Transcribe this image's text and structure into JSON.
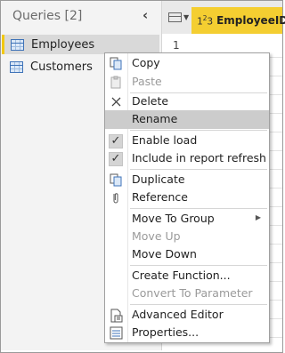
{
  "queries_pane": {
    "title": "Queries [2]",
    "items": [
      {
        "label": "Employees",
        "selected": true,
        "icon": "table-icon"
      },
      {
        "label": "Customers",
        "selected": false,
        "icon": "table-icon"
      }
    ]
  },
  "grid": {
    "column_header": "EmployeeID",
    "type_icon": "123",
    "row_number": "1"
  },
  "context_menu": {
    "items": [
      {
        "label": "Copy",
        "icon": "copy-icon",
        "enabled": true
      },
      {
        "label": "Paste",
        "icon": "paste-icon",
        "enabled": false
      },
      {
        "label": "Delete",
        "icon": "delete-icon",
        "enabled": true
      },
      {
        "label": "Rename",
        "icon": "rename-icon",
        "enabled": true,
        "highlighted": true
      },
      {
        "label": "Enable load",
        "icon": "checkbox-icon",
        "checked": true,
        "enabled": true
      },
      {
        "label": "Include in report refresh",
        "icon": "checkbox-icon",
        "checked": true,
        "enabled": true
      },
      {
        "label": "Duplicate",
        "icon": "duplicate-icon",
        "enabled": true
      },
      {
        "label": "Reference",
        "icon": "reference-icon",
        "enabled": true
      },
      {
        "label": "Move To Group",
        "icon": "",
        "enabled": true,
        "submenu": true
      },
      {
        "label": "Move Up",
        "icon": "",
        "enabled": false
      },
      {
        "label": "Move Down",
        "icon": "",
        "enabled": true
      },
      {
        "label": "Create Function...",
        "icon": "",
        "enabled": true
      },
      {
        "label": "Convert To Parameter",
        "icon": "",
        "enabled": false
      },
      {
        "label": "Advanced Editor",
        "icon": "advanced-editor-icon",
        "enabled": true
      },
      {
        "label": "Properties...",
        "icon": "properties-icon",
        "enabled": true
      }
    ]
  },
  "colors": {
    "accent_yellow": "#f4ce31",
    "selection_bar": "#f2c811",
    "menu_hover": "#cccccc",
    "disabled_text": "#9a9a9a"
  }
}
